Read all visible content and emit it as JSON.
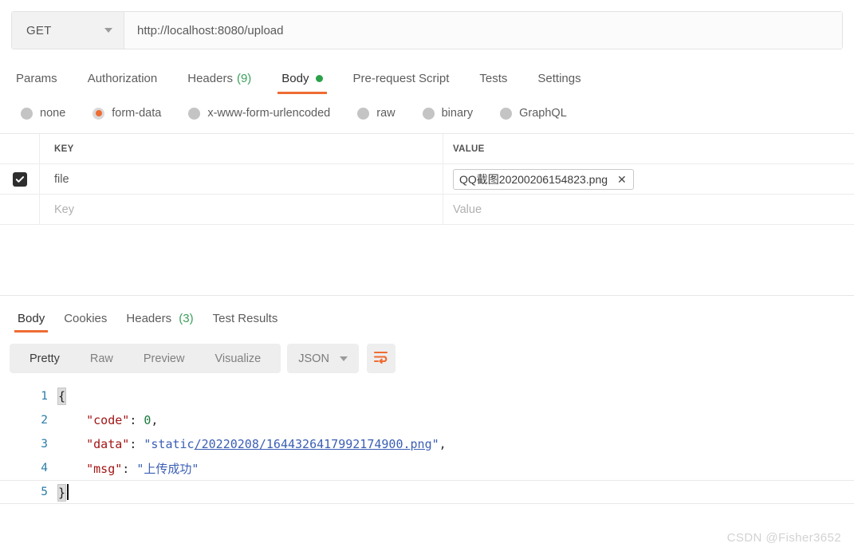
{
  "request": {
    "method": "GET",
    "url": "http://localhost:8080/upload",
    "tabs": [
      {
        "label": "Params",
        "active": false
      },
      {
        "label": "Authorization",
        "active": false
      },
      {
        "label": "Headers",
        "count": "(9)",
        "active": false
      },
      {
        "label": "Body",
        "active": true,
        "dot": true
      },
      {
        "label": "Pre-request Script",
        "active": false
      },
      {
        "label": "Tests",
        "active": false
      },
      {
        "label": "Settings",
        "active": false
      }
    ],
    "body_types": [
      {
        "label": "none",
        "selected": false
      },
      {
        "label": "form-data",
        "selected": true
      },
      {
        "label": "x-www-form-urlencoded",
        "selected": false
      },
      {
        "label": "raw",
        "selected": false
      },
      {
        "label": "binary",
        "selected": false
      },
      {
        "label": "GraphQL",
        "selected": false
      }
    ],
    "table": {
      "columns": {
        "key": "KEY",
        "value": "VALUE"
      },
      "rows": [
        {
          "checked": true,
          "key": "file",
          "value": "QQ截图20200206154823.png",
          "is_file": true
        },
        {
          "checked": false,
          "key_placeholder": "Key",
          "value_placeholder": "Value",
          "is_file": false
        }
      ]
    }
  },
  "response": {
    "tabs": [
      {
        "label": "Body",
        "active": true
      },
      {
        "label": "Cookies",
        "active": false
      },
      {
        "label": "Headers",
        "count": "(3)",
        "active": false
      },
      {
        "label": "Test Results",
        "active": false
      }
    ],
    "view_modes": [
      {
        "label": "Pretty",
        "active": true
      },
      {
        "label": "Raw",
        "active": false
      },
      {
        "label": "Preview",
        "active": false
      },
      {
        "label": "Visualize",
        "active": false
      }
    ],
    "format": "JSON",
    "wrap_icon": "wrap-text-icon",
    "code": {
      "lines": [
        {
          "n": "1",
          "parts": [
            {
              "t": "brace",
              "v": "{"
            }
          ]
        },
        {
          "n": "2",
          "parts": [
            {
              "t": "plain",
              "v": "    "
            },
            {
              "t": "key",
              "v": "\"code\""
            },
            {
              "t": "punct",
              "v": ": "
            },
            {
              "t": "num",
              "v": "0"
            },
            {
              "t": "punct",
              "v": ","
            }
          ]
        },
        {
          "n": "3",
          "parts": [
            {
              "t": "plain",
              "v": "    "
            },
            {
              "t": "key",
              "v": "\"data\""
            },
            {
              "t": "punct",
              "v": ": "
            },
            {
              "t": "str",
              "v": "\"static"
            },
            {
              "t": "link",
              "v": "/20220208/1644326417992174900.png"
            },
            {
              "t": "str",
              "v": "\""
            },
            {
              "t": "punct",
              "v": ","
            }
          ]
        },
        {
          "n": "4",
          "parts": [
            {
              "t": "plain",
              "v": "    "
            },
            {
              "t": "key",
              "v": "\"msg\""
            },
            {
              "t": "punct",
              "v": ": "
            },
            {
              "t": "str",
              "v": "\"上传成功\""
            }
          ]
        },
        {
          "n": "5",
          "active": true,
          "cursor": true,
          "parts": [
            {
              "t": "brace",
              "v": "}"
            }
          ]
        }
      ]
    }
  },
  "watermark": "CSDN @Fisher3652",
  "colors": {
    "accent": "#ef6c33",
    "green": "#2ca14a",
    "count_green": "#3aa05a",
    "lineno": "#2b7ca8",
    "json_key": "#a31515",
    "json_string": "#3b5fb5",
    "json_number": "#1a7a3c"
  }
}
